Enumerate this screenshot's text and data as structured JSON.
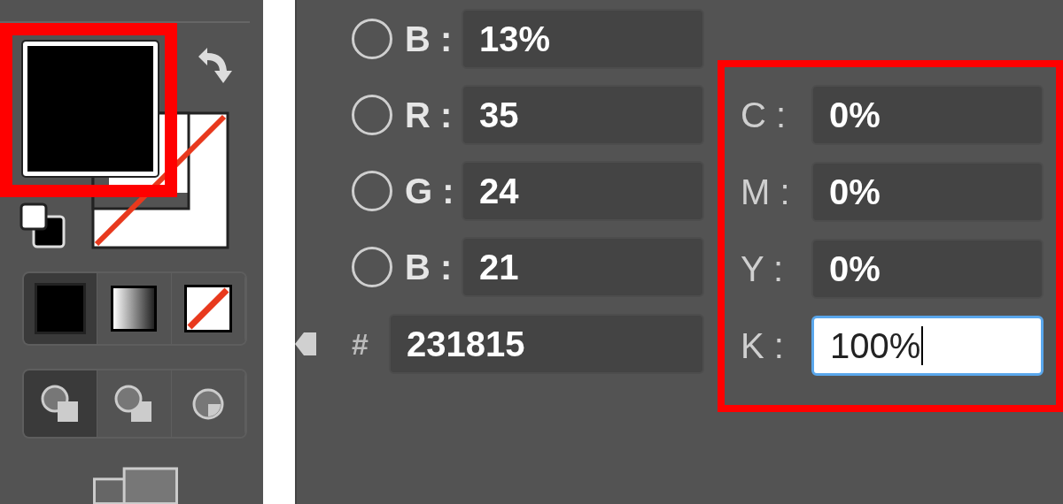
{
  "fill_type_buttons": [
    {
      "kind": "color",
      "selected": true
    },
    {
      "kind": "gradient",
      "selected": false
    },
    {
      "kind": "none",
      "selected": false
    }
  ],
  "draw_mode_buttons": [
    {
      "kind": "normal",
      "selected": true
    },
    {
      "kind": "behind",
      "selected": false
    },
    {
      "kind": "inside",
      "selected": false
    }
  ],
  "hsb_rgb_fields": [
    {
      "label": "B :",
      "value": "13%",
      "selected": false
    },
    {
      "label": "R :",
      "value": "35",
      "selected": false
    },
    {
      "label": "G :",
      "value": "24",
      "selected": false
    },
    {
      "label": "B :",
      "value": "21",
      "selected": false
    }
  ],
  "hex_field": {
    "label": "#",
    "value": "231815"
  },
  "cmyk_fields": [
    {
      "label": "C :",
      "value": "0%",
      "focused": false
    },
    {
      "label": "M :",
      "value": "0%",
      "focused": false
    },
    {
      "label": "Y :",
      "value": "0%",
      "focused": false
    },
    {
      "label": "K :",
      "value": "100%",
      "focused": true
    }
  ]
}
